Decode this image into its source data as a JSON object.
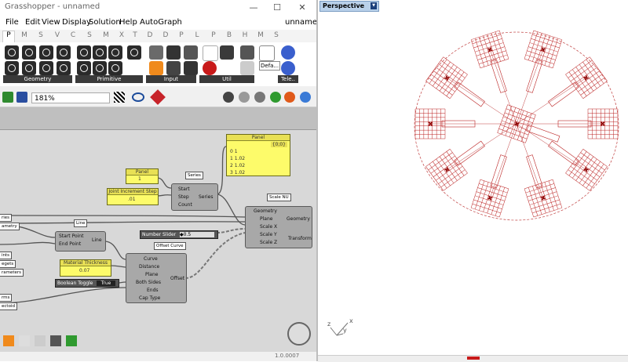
{
  "window": {
    "title": "Grasshopper - unnamed",
    "doc_name": "unnamed",
    "minimize": "—",
    "maximize": "☐",
    "close": "✕"
  },
  "menu": [
    "File",
    "Edit",
    "View",
    "Display",
    "Solution",
    "Help",
    "AutoGraph"
  ],
  "tabs": [
    "P",
    "M",
    "S",
    "V",
    "C",
    "S",
    "M",
    "X",
    "T",
    "D",
    "D",
    "P",
    "L",
    "P",
    "B",
    "H",
    "M",
    "S"
  ],
  "ribbon_groups": [
    "Geometry",
    "Primitive",
    "Input",
    "Util",
    "Tele.."
  ],
  "ribbon_extra": "Defa...",
  "zoom_value": "181%",
  "status_version": "1.0.0007",
  "nodes": {
    "panel_top": {
      "title": "Panel",
      "header": "{0;0}",
      "rows": [
        "0  1",
        "1  1.02",
        "2  1.02",
        "3  1.02"
      ]
    },
    "panel_small": {
      "title": "Panel",
      "value": "1"
    },
    "joint_increment": {
      "title": "Joint Increment Step",
      "value": ".01"
    },
    "series": {
      "tag": "Series",
      "inputs": [
        "Start",
        "Step",
        "Count"
      ],
      "output": "Series"
    },
    "scale_nu": {
      "tag": "Scale NU",
      "inputs": [
        "Geometry",
        "Plane",
        "Scale X",
        "Scale Y",
        "Scale Z"
      ],
      "outputs": [
        "Geometry",
        "Transform"
      ]
    },
    "line": {
      "tag": "Line",
      "inputs": [
        "Start Point",
        "End Point"
      ],
      "output": "Line"
    },
    "number_slider": {
      "label": "Number Slider",
      "value": "◆0.5"
    },
    "offset_curve": {
      "tag": "Offset Curve",
      "inputs": [
        "Curve",
        "Distance",
        "Plane",
        "Both Sides",
        "Ends",
        "Cap Type"
      ],
      "output": "Offset"
    },
    "material_thickness": {
      "title": "Material Thickness",
      "value": "0.07"
    },
    "boolean_toggle": {
      "label": "Boolean Toggle",
      "value": "True"
    },
    "left_ports": [
      "ries",
      "ametry",
      "ints",
      "egets",
      "rameters",
      "rms",
      "ectoid"
    ]
  },
  "viewport": {
    "label": "Perspective",
    "axes": {
      "x": "x",
      "y": "y",
      "z": "z"
    }
  }
}
